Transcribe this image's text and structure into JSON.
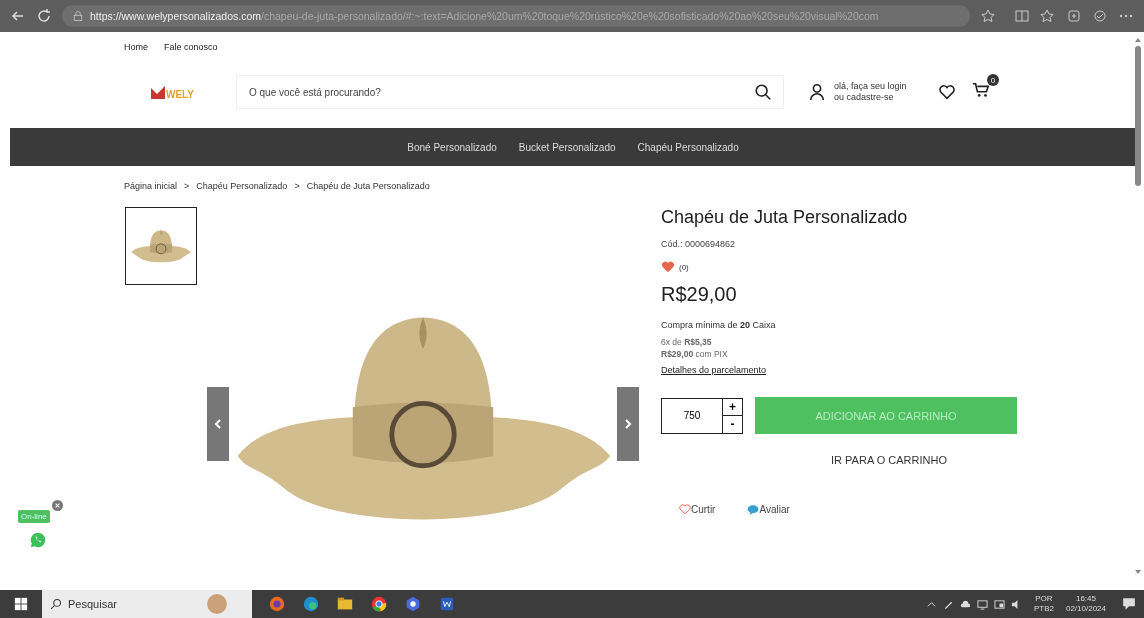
{
  "browser": {
    "url_host": "https://www.welypersonalizados.com",
    "url_path": "/chapeu-de-juta-personalizado/#:~:text=Adicione%20um%20toque%20rústico%20e%20sofisticado%20ao%20seu%20visual%20com"
  },
  "top_links": [
    "Home",
    "Fale conosco"
  ],
  "header": {
    "logo": "WELY",
    "search_placeholder": "O que você está procurando?",
    "login_line1": "olá, faça seu login",
    "login_line2": "ou cadastre-se",
    "cart_count": "0"
  },
  "nav": [
    "Boné Personalizado",
    "Bucket Personalizado",
    "Chapéu Personalizado"
  ],
  "breadcrumb": [
    "Página inicial",
    "Chapéu Personalizado",
    "Chapéu de Juta Personalizado"
  ],
  "breadcrumb_separator": ">",
  "product": {
    "title": "Chapéu de Juta Personalizado",
    "code": "Cód.: 0000694862",
    "likes": "(0)",
    "price": "R$29,00",
    "minimum": "Compra mínima de **20** Caixa",
    "installments": "6x de **R$5,35**",
    "pix": "**R$29,00** com PIX",
    "details_link": "Detalhes do parcelamento",
    "quantity": "750",
    "plus": "+",
    "minus": "-",
    "add_button": "ADICIONAR AO CARRINHO",
    "go_cart": "IR PARA O CARRINHO",
    "like": "Curtir",
    "review": "Avaliar"
  },
  "chat": {
    "status": "On-line"
  },
  "taskbar": {
    "search": "Pesquisar",
    "lang1": "POR",
    "lang2": "PTB2",
    "time": "16:45",
    "date": "02/10/2024"
  }
}
